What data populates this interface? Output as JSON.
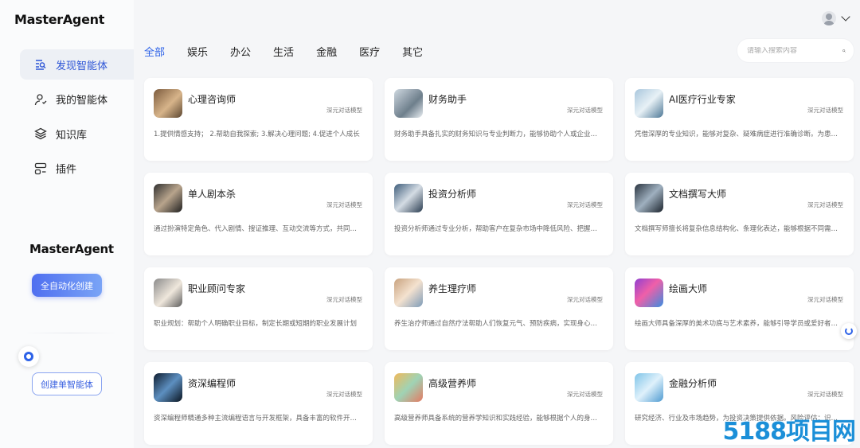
{
  "app": {
    "logo": "MasterAgent"
  },
  "sidebar": {
    "items": [
      {
        "label": "发现智能体",
        "icon": "discover-icon",
        "active": true
      },
      {
        "label": "我的智能体",
        "icon": "user-agent-icon",
        "active": false
      },
      {
        "label": "知识库",
        "icon": "layers-icon",
        "active": false
      },
      {
        "label": "插件",
        "icon": "plugin-icon",
        "active": false
      }
    ],
    "brand": "MasterAgent",
    "auto_create_label": "全自动化创建",
    "single_create_label": "创建单智能体"
  },
  "tabs": [
    {
      "label": "全部",
      "active": true
    },
    {
      "label": "娱乐",
      "active": false
    },
    {
      "label": "办公",
      "active": false
    },
    {
      "label": "生活",
      "active": false
    },
    {
      "label": "金融",
      "active": false
    },
    {
      "label": "医疗",
      "active": false
    },
    {
      "label": "其它",
      "active": false
    }
  ],
  "search": {
    "placeholder": "请输入搜索内容"
  },
  "cards": [
    {
      "name": "心理咨询师",
      "tag": "深元对话模型",
      "desc": "1.提供情感支持； 2.帮助自我探索; 3.解决心理问题; 4.促进个人成长"
    },
    {
      "name": "财务助手",
      "tag": "深元对话模型",
      "desc": "财务助手具备扎实的财务知识与专业判断力，能够协助个人或企业管理财务"
    },
    {
      "name": "AI医疗行业专家",
      "tag": "深元对话模型",
      "desc": "凭借深厚的专业知识，能够对复杂、疑难病症进行准确诊断。为患者提供"
    },
    {
      "name": "单人剧本杀",
      "tag": "深元对话模型",
      "desc": "通过扮演特定角色、代入剧情、搜证推理、互动交流等方式，共同还原真相"
    },
    {
      "name": "投资分析师",
      "tag": "深元对话模型",
      "desc": "投资分析师通过专业分析，帮助客户在复杂市场中降低风险、把握机会"
    },
    {
      "name": "文档撰写大师",
      "tag": "深元对话模型",
      "desc": "文档撰写师擅长将复杂信息结构化、条理化表达，能够根据不同需求撰写"
    },
    {
      "name": "职业顾问专家",
      "tag": "深元对话模型",
      "desc": "职业规划：帮助个人明确职业目标，制定长期或短期的职业发展计划"
    },
    {
      "name": "养生理疗师",
      "tag": "深元对话模型",
      "desc": "养生治疗师通过自然疗法帮助人们恢复元气、预防疾病，实现身心健康"
    },
    {
      "name": "绘画大师",
      "tag": "深元对话模型",
      "desc": "绘画大师具备深厚的美术功底与艺术素养，能够引导学员或爱好者提升"
    },
    {
      "name": "资深编程师",
      "tag": "深元对话模型",
      "desc": "资深编程师精通多种主流编程语言与开发框架，具备丰富的软件开发经验"
    },
    {
      "name": "高级营养师",
      "tag": "深元对话模型",
      "desc": "高级营养师具备系统的营养学知识和实践经验，能够根据个人的身体状况"
    },
    {
      "name": "金融分析师",
      "tag": "深元对话模型",
      "desc": "研究经济、行业及市场趋势，为投资决策提供依据。风险评估：识别潜在"
    }
  ],
  "watermark": "5188项目网"
}
